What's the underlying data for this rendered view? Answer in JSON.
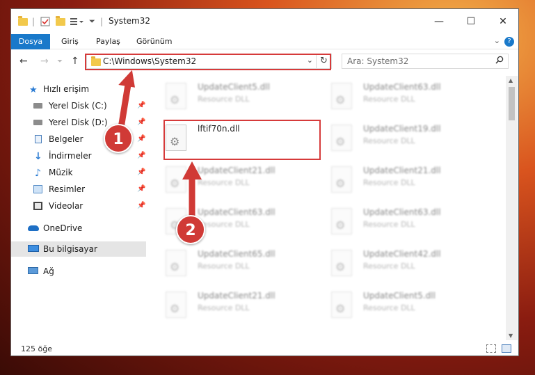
{
  "window": {
    "title": "System32",
    "controls": {
      "minimize": "—",
      "maximize": "☐",
      "close": "✕"
    }
  },
  "ribbon": {
    "tabs": [
      "Dosya",
      "Giriş",
      "Paylaş",
      "Görünüm"
    ],
    "help": "?",
    "collapse": "⌄"
  },
  "nav": {
    "back": "←",
    "forward": "→",
    "up": "↑",
    "address": "C:\\Windows\\System32",
    "dropdown": "⌄",
    "refresh": "↻",
    "search_placeholder": "Ara: System32",
    "search_icon": "⚲"
  },
  "sidebar": {
    "items": [
      {
        "label": "Hızlı erişim",
        "icon": "star-icon",
        "pinned": false
      },
      {
        "label": "Yerel Disk (C:)",
        "icon": "drive-icon",
        "pinned": true
      },
      {
        "label": "Yerel Disk (D:)",
        "icon": "drive-icon",
        "pinned": true
      },
      {
        "label": "Belgeler",
        "icon": "documents-icon",
        "pinned": true
      },
      {
        "label": "İndirmeler",
        "icon": "download-icon",
        "pinned": true
      },
      {
        "label": "Müzik",
        "icon": "music-icon",
        "pinned": true
      },
      {
        "label": "Resimler",
        "icon": "pictures-icon",
        "pinned": true
      },
      {
        "label": "Videolar",
        "icon": "videos-icon",
        "pinned": true
      },
      {
        "label": "OneDrive",
        "icon": "cloud-icon",
        "pinned": false
      },
      {
        "label": "Bu bilgisayar",
        "icon": "computer-icon",
        "pinned": false
      },
      {
        "label": "Ağ",
        "icon": "network-icon",
        "pinned": false
      }
    ],
    "pin_glyph": "📌"
  },
  "files": {
    "left": [
      {
        "name": "UpdateClient5.dll",
        "type": "Resource DLL",
        "blurred": true
      },
      {
        "name": "lftif70n.dll",
        "type": "",
        "blurred": false
      },
      {
        "name": "UpdateClient21.dll",
        "type": "Resource DLL",
        "blurred": true
      },
      {
        "name": "UpdateClient63.dll",
        "type": "Resource DLL",
        "blurred": true
      },
      {
        "name": "UpdateClient65.dll",
        "type": "Resource DLL",
        "blurred": true
      },
      {
        "name": "UpdateClient21.dll",
        "type": "Resource DLL",
        "blurred": true
      }
    ],
    "right": [
      {
        "name": "UpdateClient63.dll",
        "type": "Resource DLL",
        "blurred": true
      },
      {
        "name": "UpdateClient19.dll",
        "type": "Resource DLL",
        "blurred": true
      },
      {
        "name": "UpdateClient21.dll",
        "type": "Resource DLL",
        "blurred": true
      },
      {
        "name": "UpdateClient63.dll",
        "type": "Resource DLL",
        "blurred": true
      },
      {
        "name": "UpdateClient42.dll",
        "type": "Resource DLL",
        "blurred": true
      },
      {
        "name": "UpdateClient5.dll",
        "type": "Resource DLL",
        "blurred": true
      }
    ]
  },
  "status": {
    "count": "125 öğe"
  },
  "annotations": {
    "step1": "1",
    "step2": "2",
    "color": "#d63a3a"
  }
}
